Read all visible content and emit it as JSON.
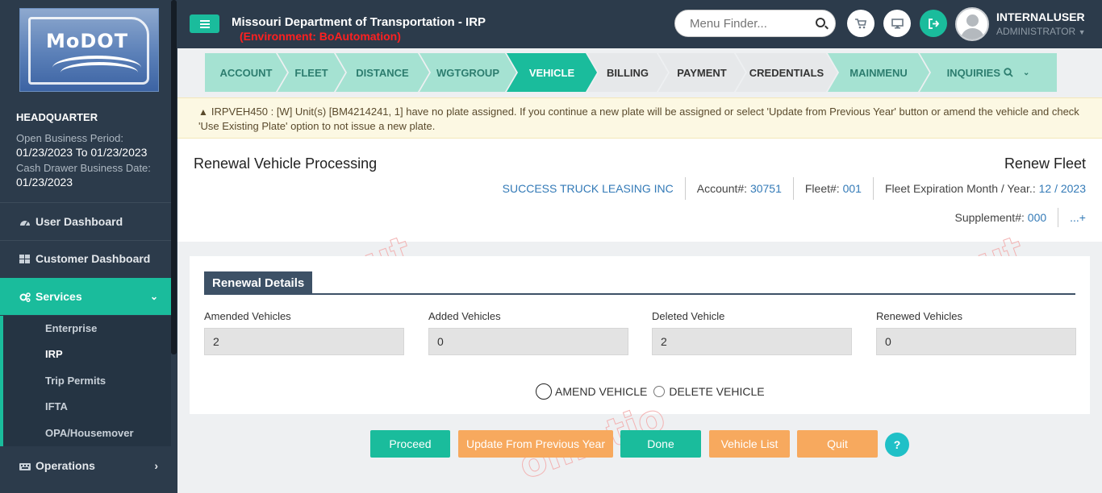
{
  "sidebar": {
    "logo_text": "MoDOT",
    "office": "HEADQUARTER",
    "open_period_label": "Open Business Period:",
    "open_period_value": "01/23/2023 To 01/23/2023",
    "cash_drawer_label": "Cash Drawer Business Date:",
    "cash_drawer_value": "01/23/2023",
    "nav": [
      {
        "label": "User Dashboard",
        "icon": "dashboard-icon"
      },
      {
        "label": "Customer Dashboard",
        "icon": "grid-icon"
      },
      {
        "label": "Services",
        "icon": "cogs-icon"
      },
      {
        "label": "Operations",
        "icon": "keyboard-icon"
      }
    ],
    "services_sub": [
      "Enterprise",
      "IRP",
      "Trip Permits",
      "IFTA",
      "OPA/Housemover"
    ]
  },
  "header": {
    "title": "Missouri Department of Transportation - IRP",
    "environment": "(Environment: BoAutomation)",
    "menu_finder_placeholder": "Menu Finder...",
    "user_name": "INTERNALUSER",
    "user_role": "ADMINISTRATOR"
  },
  "wizard": {
    "steps": [
      "ACCOUNT",
      "FLEET",
      "DISTANCE",
      "WGTGROUP",
      "VEHICLE",
      "BILLING",
      "PAYMENT",
      "CREDENTIALS",
      "MAINMENU",
      "INQUIRIES"
    ],
    "current": "VEHICLE"
  },
  "warning": {
    "text": "IRPVEH450 : [W] Unit(s) [BM4214241, 1] have no plate assigned. If you continue a new plate will be assigned or select 'Update from Previous Year' button or amend the vehicle and check 'Use Existing Plate' option to not issue a new plate."
  },
  "page": {
    "title": "Renewal Vehicle Processing",
    "right_title": "Renew Fleet",
    "company": "SUCCESS TRUCK LEASING INC",
    "account_label": "Account#:",
    "account_value": "30751",
    "fleet_label": "Fleet#:",
    "fleet_value": "001",
    "expiration_label": "Fleet Expiration Month / Year.:",
    "expiration_value": "12 / 2023",
    "supplement_label": "Supplement#:",
    "supplement_value": "000",
    "more_link": "...+"
  },
  "renewal": {
    "section_title": "Renewal Details",
    "fields": [
      {
        "label": "Amended Vehicles",
        "value": "2"
      },
      {
        "label": "Added Vehicles",
        "value": "0"
      },
      {
        "label": "Deleted Vehicle",
        "value": "2"
      },
      {
        "label": "Renewed Vehicles",
        "value": "0"
      }
    ],
    "radio_amend": "AMEND VEHICLE",
    "radio_delete": "DELETE VEHICLE"
  },
  "buttons": {
    "proceed": "Proceed",
    "update_prev": "Update From Previous Year",
    "done": "Done",
    "vehicle_list": "Vehicle List",
    "quit": "Quit",
    "help": "?"
  },
  "colors": {
    "sidebar_bg": "#2c3b4b",
    "accent": "#1abc9c",
    "orange": "#f7a95e",
    "env_red": "#ff2020",
    "link_blue": "#337ab7"
  }
}
